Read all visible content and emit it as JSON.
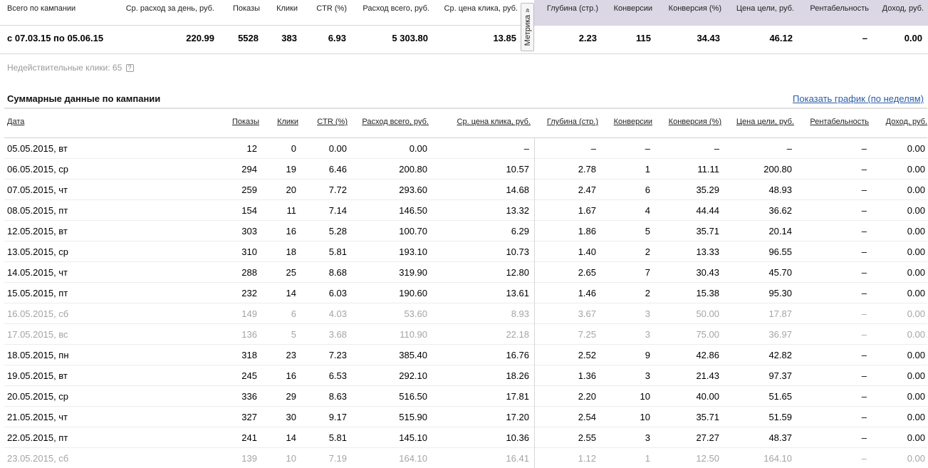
{
  "summary": {
    "headers": {
      "campaign": "Всего по кампании",
      "avg_spend": "Ср. расход за день, руб.",
      "shows": "Показы",
      "clicks": "Клики",
      "ctr": "CTR (%)",
      "spend_total": "Расход всего, руб.",
      "cpc": "Ср. цена клика, руб.",
      "depth": "Глубина (стр.)",
      "conversions": "Конверсии",
      "conv_rate": "Конверсия (%)",
      "goal_cost": "Цена цели, руб.",
      "profitability": "Рентабельность",
      "revenue": "Доход, руб."
    },
    "values": {
      "campaign": "с 07.03.15 по 05.06.15",
      "avg_spend": "220.99",
      "shows": "5528",
      "clicks": "383",
      "ctr": "6.93",
      "spend_total": "5 303.80",
      "cpc": "13.85",
      "depth": "2.23",
      "conversions": "115",
      "conv_rate": "34.43",
      "goal_cost": "46.12",
      "profitability": "–",
      "revenue": "0.00"
    },
    "metrika_tab": "Метрика »"
  },
  "invalid_clicks": {
    "label": "Недействительные клики: 65",
    "help": "?"
  },
  "section": {
    "title": "Суммарные данные по кампании",
    "graph_link": "Показать график (по неделям)"
  },
  "table": {
    "headers": {
      "date": "Дата",
      "shows": "Показы",
      "clicks": "Клики",
      "ctr": "CTR (%)",
      "spend": "Расход всего, руб.",
      "cpc": "Ср. цена клика, руб.",
      "depth": "Глубина (стр.)",
      "conv": "Конверсии",
      "conv_rate": "Конверсия (%)",
      "goal_cost": "Цена цели, руб.",
      "profitability": "Рентабельность",
      "revenue": "Доход, руб."
    },
    "rows": [
      {
        "date": "05.05.2015, вт",
        "shows": "12",
        "clicks": "0",
        "ctr": "0.00",
        "spend": "0.00",
        "cpc": "–",
        "depth": "–",
        "conv": "–",
        "conv_rate": "–",
        "goal_cost": "–",
        "profitability": "–",
        "revenue": "0.00",
        "weekend": false
      },
      {
        "date": "06.05.2015, ср",
        "shows": "294",
        "clicks": "19",
        "ctr": "6.46",
        "spend": "200.80",
        "cpc": "10.57",
        "depth": "2.78",
        "conv": "1",
        "conv_rate": "11.11",
        "goal_cost": "200.80",
        "profitability": "–",
        "revenue": "0.00",
        "weekend": false
      },
      {
        "date": "07.05.2015, чт",
        "shows": "259",
        "clicks": "20",
        "ctr": "7.72",
        "spend": "293.60",
        "cpc": "14.68",
        "depth": "2.47",
        "conv": "6",
        "conv_rate": "35.29",
        "goal_cost": "48.93",
        "profitability": "–",
        "revenue": "0.00",
        "weekend": false
      },
      {
        "date": "08.05.2015, пт",
        "shows": "154",
        "clicks": "11",
        "ctr": "7.14",
        "spend": "146.50",
        "cpc": "13.32",
        "depth": "1.67",
        "conv": "4",
        "conv_rate": "44.44",
        "goal_cost": "36.62",
        "profitability": "–",
        "revenue": "0.00",
        "weekend": false
      },
      {
        "date": "12.05.2015, вт",
        "shows": "303",
        "clicks": "16",
        "ctr": "5.28",
        "spend": "100.70",
        "cpc": "6.29",
        "depth": "1.86",
        "conv": "5",
        "conv_rate": "35.71",
        "goal_cost": "20.14",
        "profitability": "–",
        "revenue": "0.00",
        "weekend": false
      },
      {
        "date": "13.05.2015, ср",
        "shows": "310",
        "clicks": "18",
        "ctr": "5.81",
        "spend": "193.10",
        "cpc": "10.73",
        "depth": "1.40",
        "conv": "2",
        "conv_rate": "13.33",
        "goal_cost": "96.55",
        "profitability": "–",
        "revenue": "0.00",
        "weekend": false
      },
      {
        "date": "14.05.2015, чт",
        "shows": "288",
        "clicks": "25",
        "ctr": "8.68",
        "spend": "319.90",
        "cpc": "12.80",
        "depth": "2.65",
        "conv": "7",
        "conv_rate": "30.43",
        "goal_cost": "45.70",
        "profitability": "–",
        "revenue": "0.00",
        "weekend": false
      },
      {
        "date": "15.05.2015, пт",
        "shows": "232",
        "clicks": "14",
        "ctr": "6.03",
        "spend": "190.60",
        "cpc": "13.61",
        "depth": "1.46",
        "conv": "2",
        "conv_rate": "15.38",
        "goal_cost": "95.30",
        "profitability": "–",
        "revenue": "0.00",
        "weekend": false
      },
      {
        "date": "16.05.2015, сб",
        "shows": "149",
        "clicks": "6",
        "ctr": "4.03",
        "spend": "53.60",
        "cpc": "8.93",
        "depth": "3.67",
        "conv": "3",
        "conv_rate": "50.00",
        "goal_cost": "17.87",
        "profitability": "–",
        "revenue": "0.00",
        "weekend": true
      },
      {
        "date": "17.05.2015, вс",
        "shows": "136",
        "clicks": "5",
        "ctr": "3.68",
        "spend": "110.90",
        "cpc": "22.18",
        "depth": "7.25",
        "conv": "3",
        "conv_rate": "75.00",
        "goal_cost": "36.97",
        "profitability": "–",
        "revenue": "0.00",
        "weekend": true
      },
      {
        "date": "18.05.2015, пн",
        "shows": "318",
        "clicks": "23",
        "ctr": "7.23",
        "spend": "385.40",
        "cpc": "16.76",
        "depth": "2.52",
        "conv": "9",
        "conv_rate": "42.86",
        "goal_cost": "42.82",
        "profitability": "–",
        "revenue": "0.00",
        "weekend": false
      },
      {
        "date": "19.05.2015, вт",
        "shows": "245",
        "clicks": "16",
        "ctr": "6.53",
        "spend": "292.10",
        "cpc": "18.26",
        "depth": "1.36",
        "conv": "3",
        "conv_rate": "21.43",
        "goal_cost": "97.37",
        "profitability": "–",
        "revenue": "0.00",
        "weekend": false
      },
      {
        "date": "20.05.2015, ср",
        "shows": "336",
        "clicks": "29",
        "ctr": "8.63",
        "spend": "516.50",
        "cpc": "17.81",
        "depth": "2.20",
        "conv": "10",
        "conv_rate": "40.00",
        "goal_cost": "51.65",
        "profitability": "–",
        "revenue": "0.00",
        "weekend": false
      },
      {
        "date": "21.05.2015, чт",
        "shows": "327",
        "clicks": "30",
        "ctr": "9.17",
        "spend": "515.90",
        "cpc": "17.20",
        "depth": "2.54",
        "conv": "10",
        "conv_rate": "35.71",
        "goal_cost": "51.59",
        "profitability": "–",
        "revenue": "0.00",
        "weekend": false
      },
      {
        "date": "22.05.2015, пт",
        "shows": "241",
        "clicks": "14",
        "ctr": "5.81",
        "spend": "145.10",
        "cpc": "10.36",
        "depth": "2.55",
        "conv": "3",
        "conv_rate": "27.27",
        "goal_cost": "48.37",
        "profitability": "–",
        "revenue": "0.00",
        "weekend": false
      },
      {
        "date": "23.05.2015, сб",
        "shows": "139",
        "clicks": "10",
        "ctr": "7.19",
        "spend": "164.10",
        "cpc": "16.41",
        "depth": "1.12",
        "conv": "1",
        "conv_rate": "12.50",
        "goal_cost": "164.10",
        "profitability": "–",
        "revenue": "0.00",
        "weekend": true
      }
    ]
  }
}
